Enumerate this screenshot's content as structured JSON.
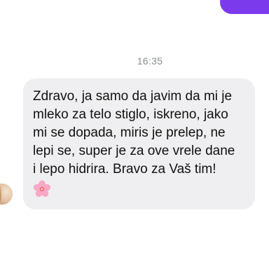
{
  "thread": {
    "timestamp": "16:35",
    "messages": [
      {
        "direction": "received",
        "text": "Zdravo, ja samo da javim da mi je\nmleko za telo stiglo, iskreno, jako\nmi se dopada, miris je prelep, ne\nlepi se, super je za ove vrele dane\ni lepo hidrira. Bravo za Vaš tim!",
        "emoji": "cherry-blossom"
      }
    ]
  },
  "colors": {
    "sent_bubble": "#7c3aed",
    "received_bubble": "#efeff1",
    "timestamp_text": "#8a8d91"
  }
}
